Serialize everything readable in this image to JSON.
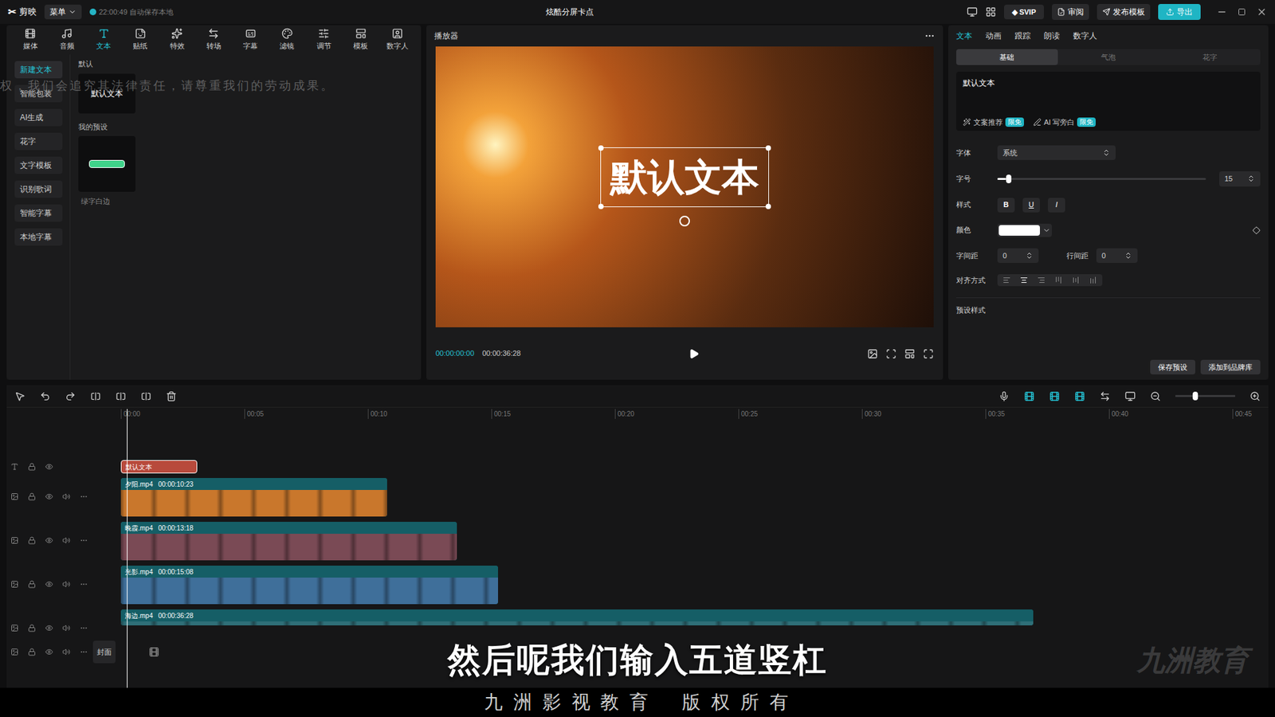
{
  "app": {
    "logo": "剪映",
    "menu": "菜单",
    "autosave": "22:00:49 自动保存本地",
    "title": "炫酷分屏卡点",
    "svip": "SVIP",
    "review": "审阅",
    "publish": "发布模板",
    "export": "导出"
  },
  "toolbar": [
    {
      "label": "媒体",
      "selected": false
    },
    {
      "label": "音频",
      "selected": false
    },
    {
      "label": "文本",
      "selected": true
    },
    {
      "label": "贴纸",
      "selected": false
    },
    {
      "label": "特效",
      "selected": false
    },
    {
      "label": "转场",
      "selected": false
    },
    {
      "label": "字幕",
      "selected": false
    },
    {
      "label": "滤镜",
      "selected": false
    },
    {
      "label": "调节",
      "selected": false
    },
    {
      "label": "模板",
      "selected": false
    },
    {
      "label": "数字人",
      "selected": false
    }
  ],
  "sidebar": [
    {
      "label": "新建文本",
      "selected": true
    },
    {
      "label": "智能包装",
      "selected": false
    },
    {
      "label": "AI生成",
      "selected": false
    },
    {
      "label": "花字",
      "selected": false
    },
    {
      "label": "文字模板",
      "selected": false
    },
    {
      "label": "识别歌词",
      "selected": false
    },
    {
      "label": "智能字幕",
      "selected": false
    },
    {
      "label": "本地字幕",
      "selected": false
    }
  ],
  "presets": {
    "default_heading": "默认",
    "default_card": "默认文本",
    "mine_heading": "我的预设",
    "mine_name": "绿字白边"
  },
  "player": {
    "title": "播放器",
    "text_box": "默认文本",
    "current": "00:00:00:00",
    "total": "00:00:36:28"
  },
  "inspector": {
    "tabs": [
      {
        "label": "文本",
        "selected": true
      },
      {
        "label": "动画",
        "selected": false
      },
      {
        "label": "跟踪",
        "selected": false
      },
      {
        "label": "朗读",
        "selected": false
      },
      {
        "label": "数字人",
        "selected": false
      }
    ],
    "subtabs": [
      {
        "label": "基础",
        "selected": true
      },
      {
        "label": "气泡",
        "selected": false
      },
      {
        "label": "花字",
        "selected": false
      }
    ],
    "text": "默认文本",
    "suggest": "文案推荐",
    "ai": "AI 写旁白",
    "badge": "限免",
    "font_label": "字体",
    "font": "系统",
    "size_label": "字号",
    "size": "15",
    "size_level": 0.04,
    "style_label": "样式",
    "style_buttons": [
      "B",
      "U",
      "I"
    ],
    "color_label": "颜色",
    "color": "#ffffff",
    "spacing_label": "字间距",
    "spacing": "0",
    "line_label": "行间距",
    "line": "0",
    "align_label": "对齐方式",
    "preset_label": "预设样式",
    "save": "保存预设",
    "brand": "添加到品牌库"
  },
  "timeline": {
    "ruler": [
      "00:00",
      "00:05",
      "00:10",
      "00:15",
      "00:20",
      "00:25",
      "00:30",
      "00:35",
      "00:40",
      "00:45"
    ],
    "text_clip": "默认文本",
    "clips": [
      {
        "name": "夕阳.mp4",
        "duration": "00:00:10:23",
        "color": "#c9772c"
      },
      {
        "name": "晚霞.mp4",
        "duration": "00:00:13:18",
        "color": "#7a4a55"
      },
      {
        "name": "光影.mp4",
        "duration": "00:00:15:08",
        "color": "#3f6f9a"
      },
      {
        "name": "海边.mp4",
        "duration": "00:00:36:28",
        "color": "#2f6f78"
      }
    ],
    "cover": "封面"
  },
  "overlays": {
    "subtitle": "然后呢我们输入五道竖杠",
    "watermark_top": "权，我们会追究其法律责任，请尊重我们的劳动成果。",
    "watermark_logo": "九洲教育",
    "copyright": "九 洲 影 视 教 育    版 权 所 有"
  }
}
